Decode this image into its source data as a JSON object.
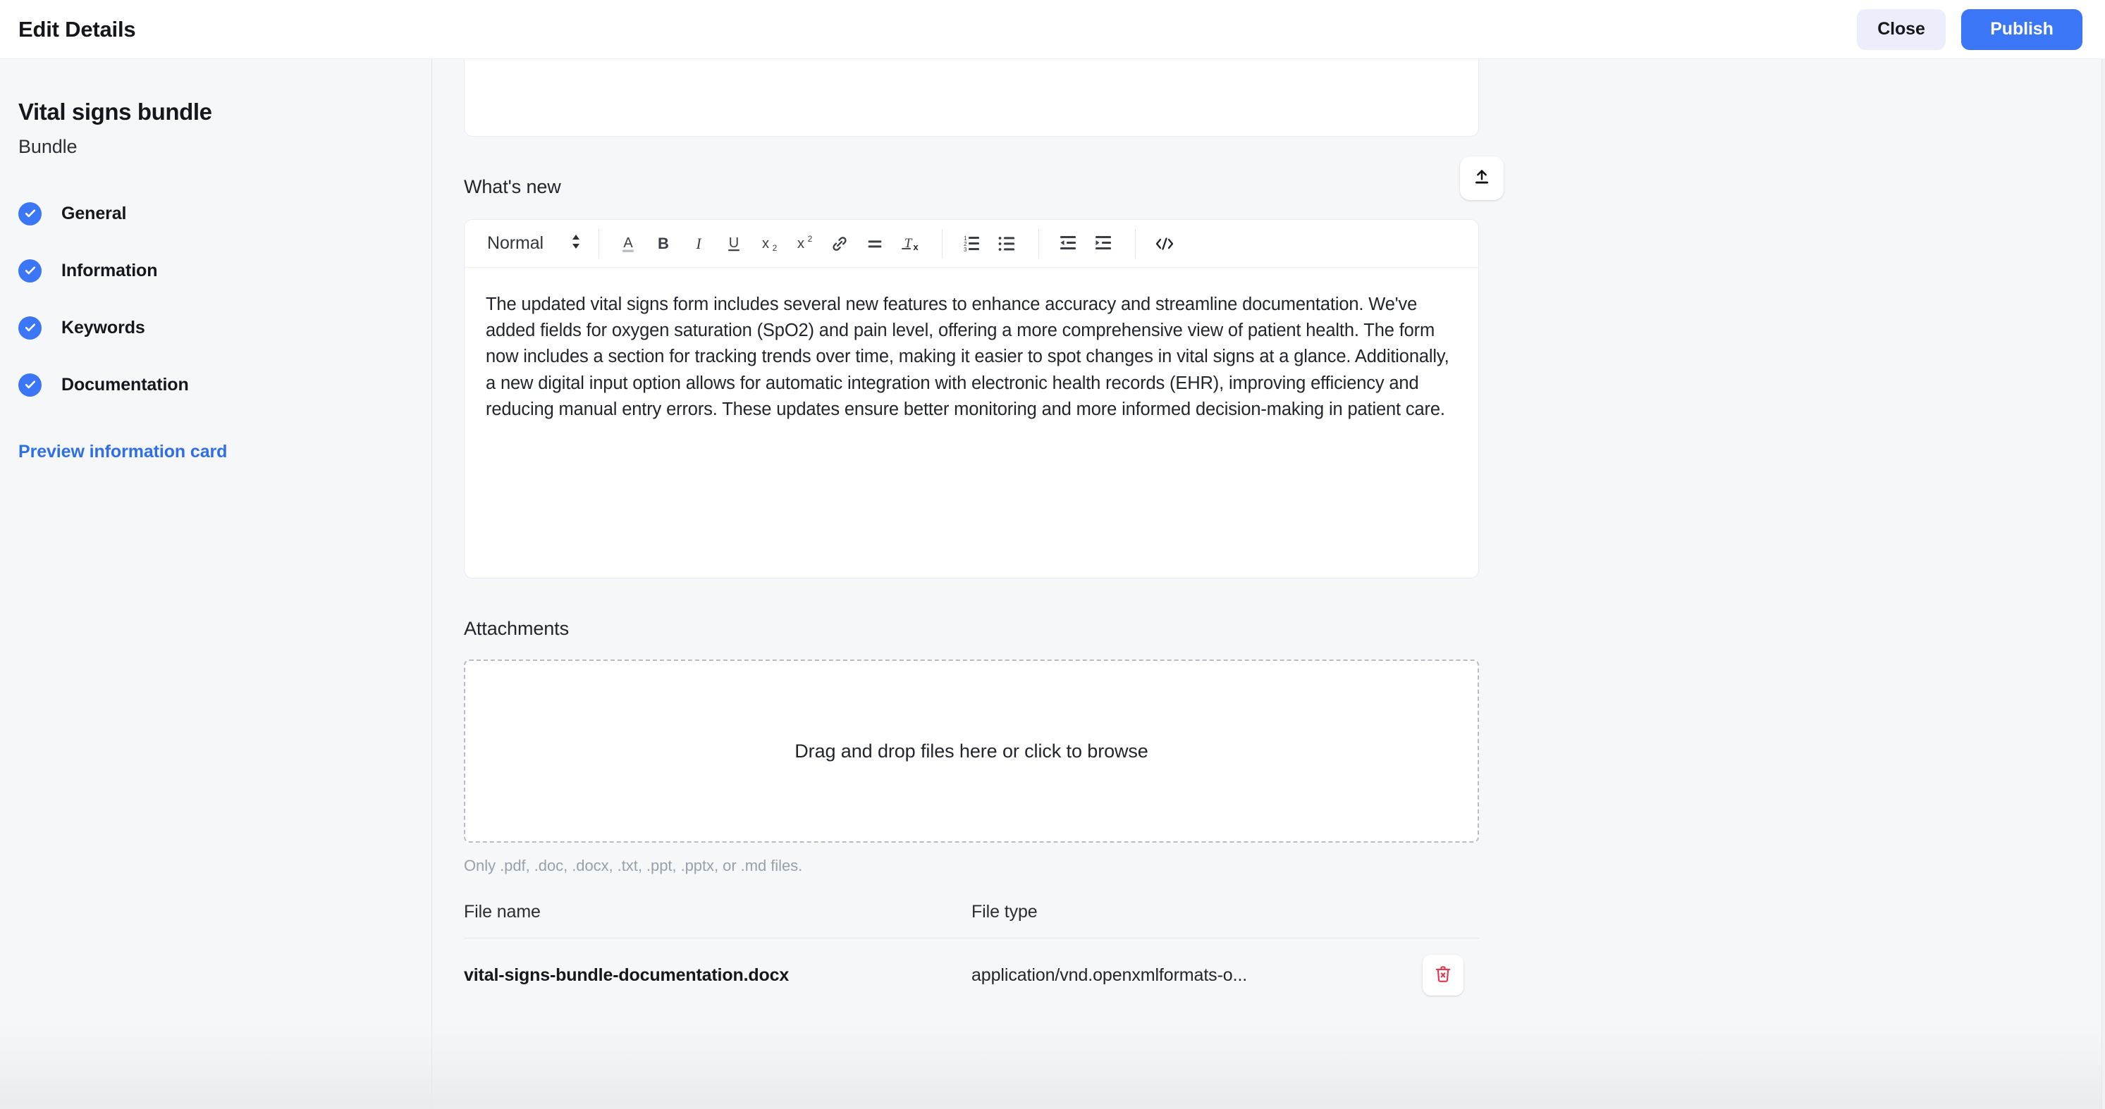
{
  "topbar": {
    "title": "Edit Details",
    "close_label": "Close",
    "publish_label": "Publish"
  },
  "sidebar": {
    "title": "Vital signs bundle",
    "subtitle": "Bundle",
    "items": [
      {
        "label": "General",
        "status": "complete"
      },
      {
        "label": "Information",
        "status": "complete"
      },
      {
        "label": "Keywords",
        "status": "complete"
      },
      {
        "label": "Documentation",
        "status": "complete"
      }
    ],
    "preview_link": "Preview information card"
  },
  "main": {
    "whats_new": {
      "label": "What's new",
      "upload_icon": "upload-icon",
      "toolbar": {
        "format_select_value": "Normal",
        "buttons": [
          {
            "icon": "text-color-icon",
            "label": "A"
          },
          {
            "icon": "bold-icon",
            "label": "B"
          },
          {
            "icon": "italic-icon",
            "label": "I"
          },
          {
            "icon": "underline-icon",
            "label": "U"
          },
          {
            "icon": "subscript-icon",
            "label": "x₂"
          },
          {
            "icon": "superscript-icon",
            "label": "x²"
          },
          {
            "icon": "link-icon",
            "label": "Link"
          },
          {
            "icon": "align-icon",
            "label": "Align"
          },
          {
            "icon": "clear-format-icon",
            "label": "Tx"
          },
          {
            "icon": "ordered-list-icon",
            "label": "Numbered list"
          },
          {
            "icon": "bullet-list-icon",
            "label": "Bullet list"
          },
          {
            "icon": "outdent-icon",
            "label": "Decrease indent"
          },
          {
            "icon": "indent-icon",
            "label": "Increase indent"
          },
          {
            "icon": "code-block-icon",
            "label": "Code"
          }
        ]
      },
      "body_paragraph": "The updated vital signs form includes several new features to enhance accuracy and streamline documentation. We've added fields for oxygen saturation (SpO2) and pain level, offering a more comprehensive view of patient health. The form now includes a section for tracking trends over time, making it easier to spot changes in vital signs at a glance. Additionally, a new digital input option allows for automatic integration with electronic health records (EHR), improving efficiency and reducing manual entry errors. These updates ensure better monitoring and more informed decision-making in patient care."
    },
    "attachments": {
      "label": "Attachments",
      "dropzone_text": "Drag and drop files here or click to browse",
      "hint": "Only .pdf, .doc, .docx, .txt, .ppt, .pptx, or .md files.",
      "table": {
        "headers": {
          "name": "File name",
          "type": "File type"
        },
        "rows": [
          {
            "name": "vital-signs-bundle-documentation.docx",
            "type": "application/vnd.openxmlformats-o...",
            "delete_icon": "trash-icon"
          }
        ]
      }
    }
  },
  "colors": {
    "accent_blue": "#3b76f6",
    "link_blue": "#2e6fe8",
    "danger_red": "#e03a4e",
    "page_bg": "#f6f7f8",
    "card_border": "#e9eaf7"
  }
}
